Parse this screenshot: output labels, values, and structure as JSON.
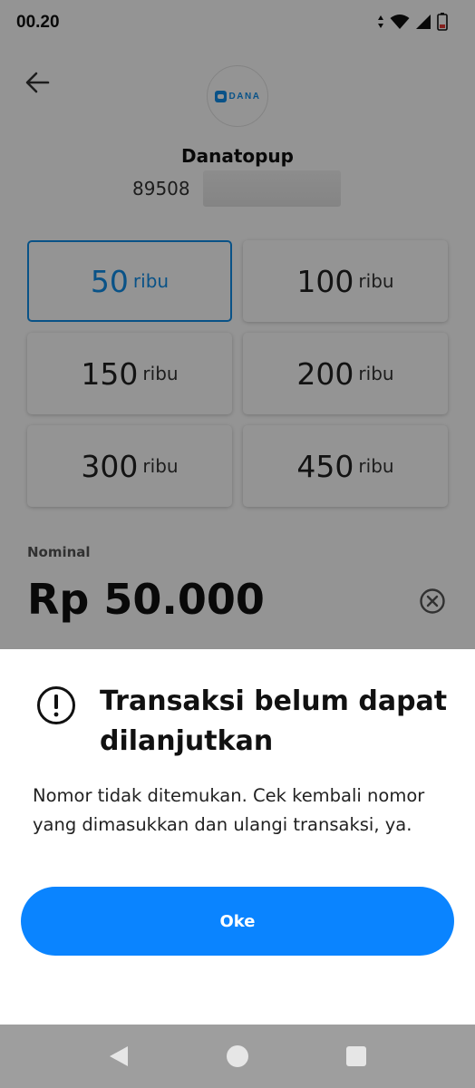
{
  "status_bar": {
    "time": "00.20"
  },
  "merchant": {
    "name": "Danatopup",
    "account_number": "89508",
    "logo_text": "DANA"
  },
  "amounts": [
    {
      "value": "50",
      "unit": "ribu",
      "selected": true
    },
    {
      "value": "100",
      "unit": "ribu",
      "selected": false
    },
    {
      "value": "150",
      "unit": "ribu",
      "selected": false
    },
    {
      "value": "200",
      "unit": "ribu",
      "selected": false
    },
    {
      "value": "300",
      "unit": "ribu",
      "selected": false
    },
    {
      "value": "450",
      "unit": "ribu",
      "selected": false
    }
  ],
  "nominal": {
    "label": "Nominal",
    "value": "Rp 50.000"
  },
  "dialog": {
    "title": "Transaksi belum dapat dilanjutkan",
    "message": "Nomor tidak ditemukan. Cek kembali nomor yang dimasukkan dan ulangi transaksi, ya.",
    "ok_label": "Oke"
  },
  "colors": {
    "accent": "#108ee9",
    "button": "#0a84ff",
    "overlay": "rgba(0,0,0,0.42)"
  },
  "icons": [
    "back-arrow-icon",
    "wifi-icon",
    "signal-icon",
    "battery-icon",
    "clear-icon",
    "alert-icon"
  ]
}
